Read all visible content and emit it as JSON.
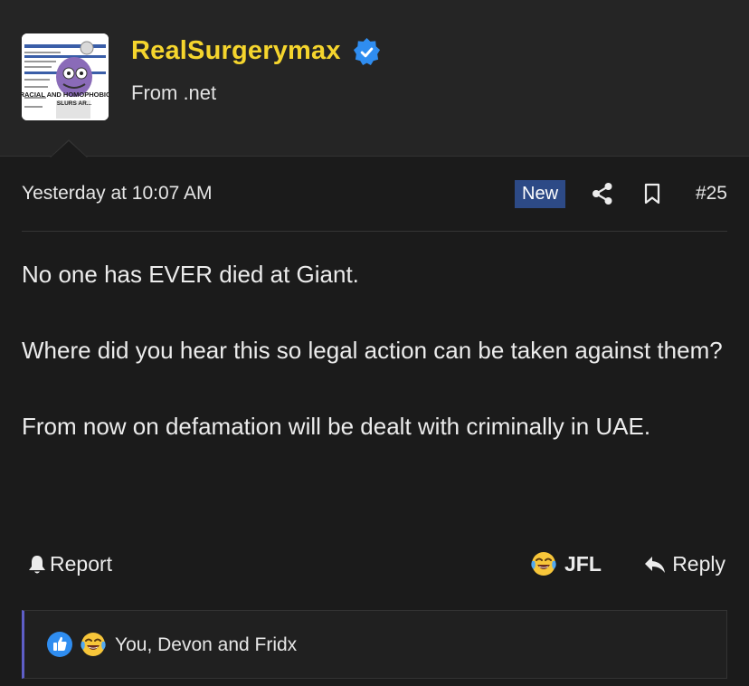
{
  "user": {
    "name": "RealSurgerymax",
    "subtitle": "From .net",
    "avatar_caption_line1": "RACIAL AND HOMOPHOBIC",
    "avatar_caption_line2": "SLURS AR...",
    "verified_icon": "verified-check-icon"
  },
  "post": {
    "timestamp": "Yesterday at 10:07 AM",
    "badge": "New",
    "number": "#25",
    "paragraphs": [
      "No one has EVER died at Giant.",
      "Where did you hear this so legal action can be taken against them?",
      "From now on defamation will be dealt with criminally in UAE."
    ]
  },
  "actions": {
    "report_label": "Report",
    "jfl_label": "JFL",
    "reply_label": "Reply"
  },
  "reactions": {
    "text": "You, Devon and Fridx",
    "icons": [
      "like-icon",
      "laughing-crying-icon"
    ]
  },
  "colors": {
    "username": "#f5d52d",
    "badge_bg": "#2d4a86",
    "verified": "#2f8df0",
    "reaction_border": "#5e5ec7",
    "background": "#1b1b1b"
  }
}
